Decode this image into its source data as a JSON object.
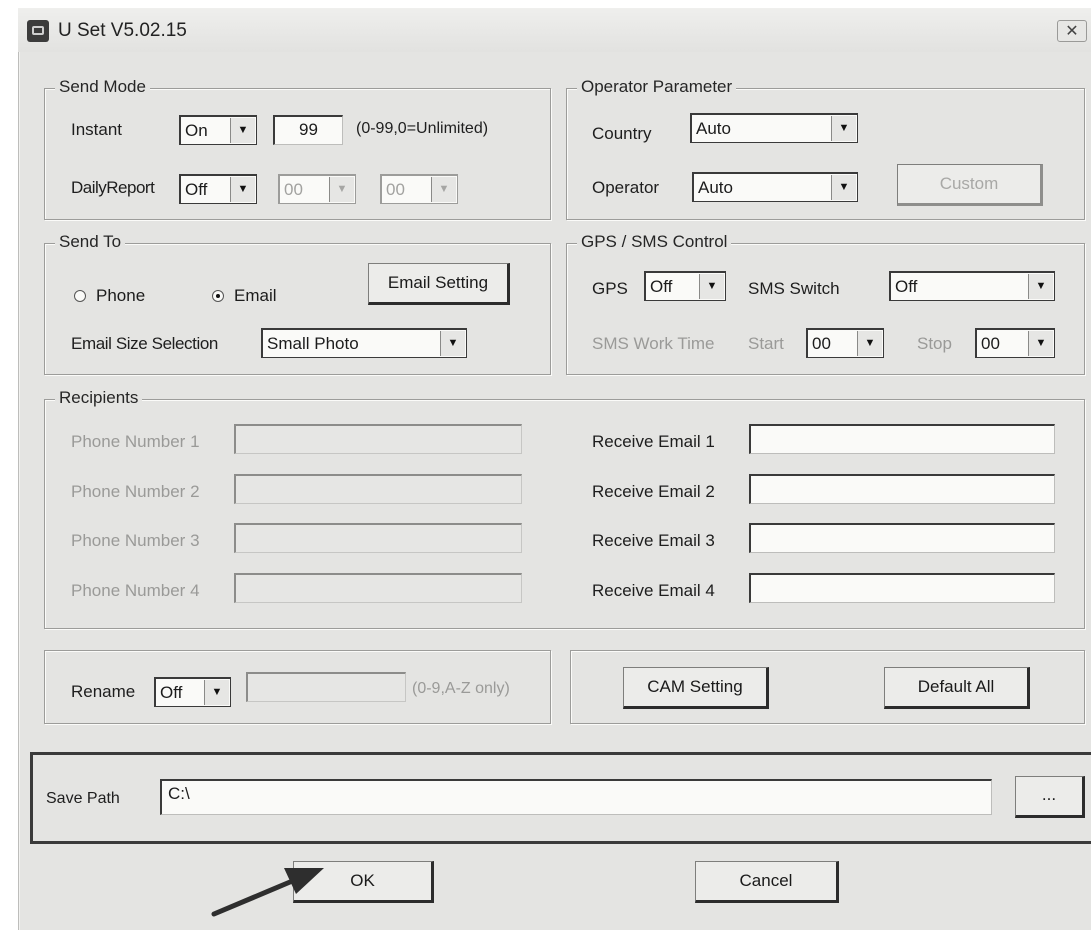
{
  "window": {
    "title": "U Set V5.02.15",
    "close_glyph": "✕"
  },
  "send_mode": {
    "legend": "Send Mode",
    "instant_label": "Instant",
    "instant_value": "On",
    "instant_count": "99",
    "instant_hint": "(0-99,0=Unlimited)",
    "daily_label": "DailyReport",
    "daily_value": "Off",
    "daily_hour": "00",
    "daily_min": "00"
  },
  "operator": {
    "legend": "Operator Parameter",
    "country_label": "Country",
    "country_value": "Auto",
    "operator_label": "Operator",
    "operator_value": "Auto",
    "custom_button": "Custom"
  },
  "send_to": {
    "legend": "Send To",
    "phone_label": "Phone",
    "email_label": "Email",
    "selected": "Email",
    "email_setting_button": "Email Setting",
    "size_label": "Email Size Selection",
    "size_value": "Small Photo"
  },
  "gps_sms": {
    "legend": "GPS / SMS Control",
    "gps_label": "GPS",
    "gps_value": "Off",
    "sms_switch_label": "SMS Switch",
    "sms_switch_value": "Off",
    "work_time_label": "SMS Work Time",
    "start_label": "Start",
    "start_value": "00",
    "stop_label": "Stop",
    "stop_value": "00"
  },
  "recipients": {
    "legend": "Recipients",
    "phones": [
      "Phone Number 1",
      "Phone Number 2",
      "Phone Number 3",
      "Phone Number 4"
    ],
    "emails": [
      "Receive Email 1",
      "Receive Email 2",
      "Receive Email 3",
      "Receive Email 4"
    ]
  },
  "rename": {
    "label": "Rename",
    "value": "Off",
    "hint": "(0-9,A-Z only)"
  },
  "actions": {
    "cam_setting": "CAM Setting",
    "default_all": "Default All"
  },
  "save_path": {
    "label": "Save Path",
    "value": "C:\\",
    "browse": "..."
  },
  "footer": {
    "ok": "OK",
    "cancel": "Cancel"
  },
  "dropdown_arrow_glyph": "▼"
}
